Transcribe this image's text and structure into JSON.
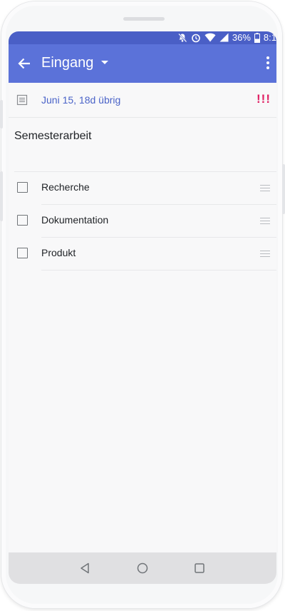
{
  "status_bar": {
    "battery_percent": "36%",
    "time": "8:1",
    "icons": [
      "mute-icon",
      "alarm-icon",
      "wifi-icon",
      "signal-icon",
      "battery-icon"
    ]
  },
  "app_bar": {
    "title": "Eingang",
    "icons": [
      "back-arrow-icon",
      "dropdown-caret-icon",
      "more-vert-icon"
    ]
  },
  "task": {
    "due_text": "Juni 15, 18d übrig",
    "priority": "!!!",
    "title": "Semesterarbeit",
    "subtasks": [
      {
        "label": "Recherche",
        "checked": false
      },
      {
        "label": "Dokumentation",
        "checked": false
      },
      {
        "label": "Produkt",
        "checked": false
      }
    ]
  },
  "colors": {
    "status_bar": "#4a5fc6",
    "app_bar": "#5b72d9",
    "accent_text": "#4a63c8",
    "priority": "#e01f63"
  },
  "nav_bar": {
    "icons": [
      "nav-back-icon",
      "nav-home-icon",
      "nav-recents-icon"
    ]
  }
}
